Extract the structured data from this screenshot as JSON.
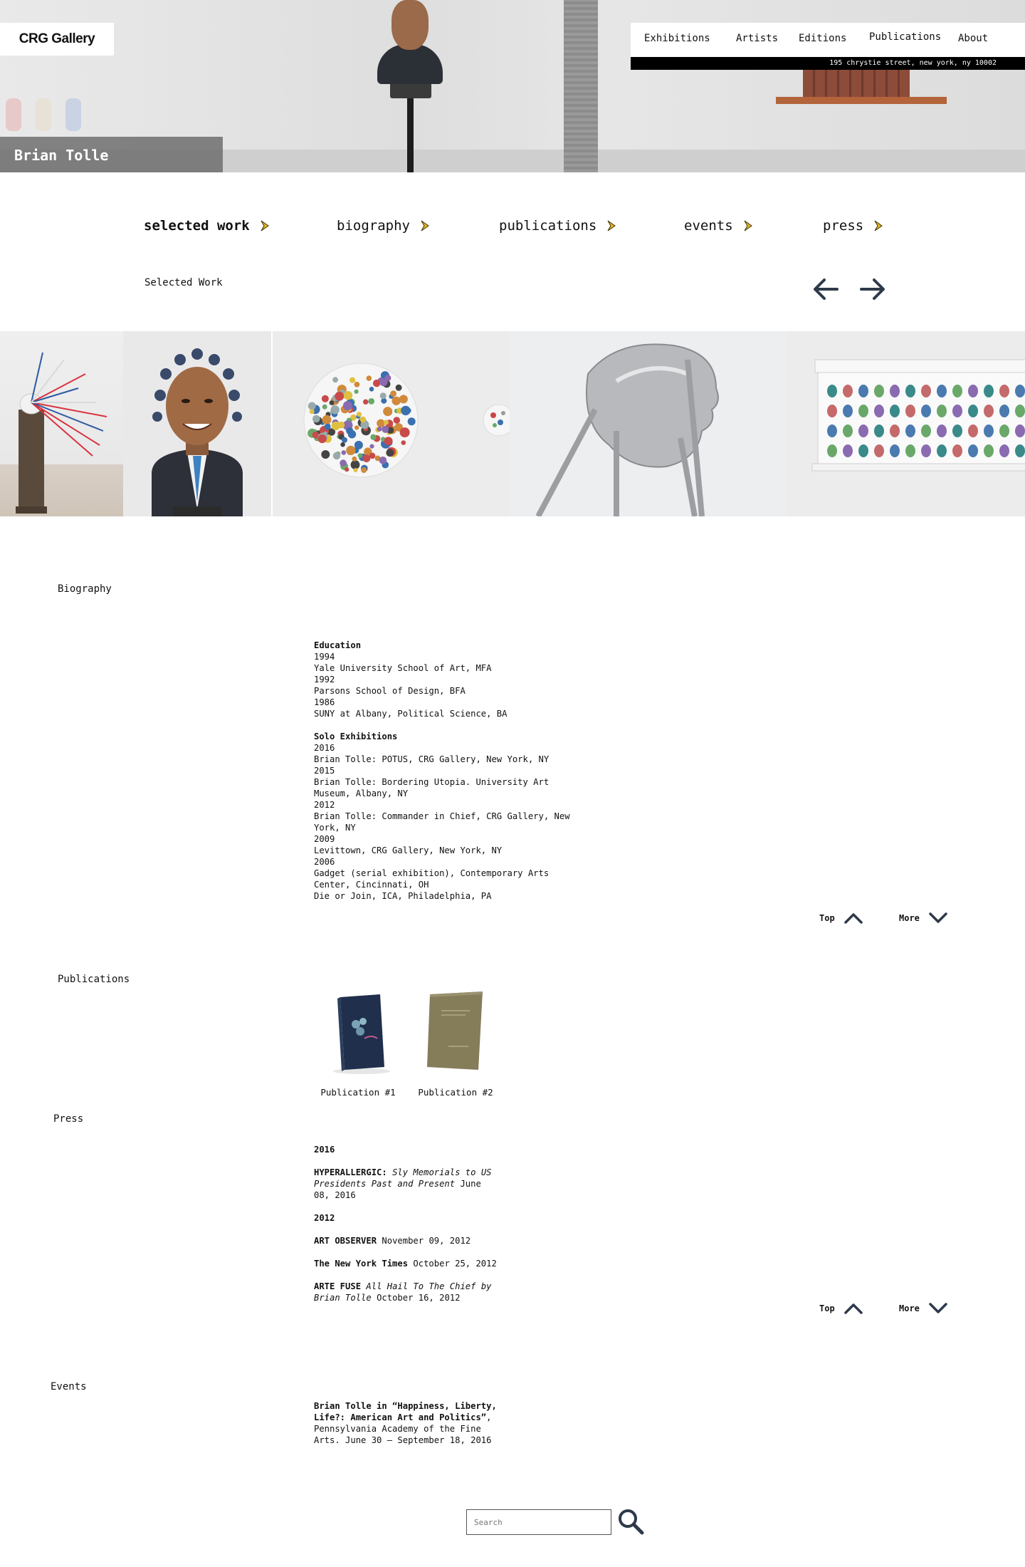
{
  "header": {
    "logo": "CRG Gallery",
    "nav": [
      "Exhibitions",
      "Artists",
      "Editions",
      "Publications",
      "About"
    ],
    "address": "195 chrystie street, new york, ny 10002"
  },
  "artist": {
    "name": "Brian Tolle"
  },
  "tabs": [
    {
      "label": "selected work",
      "active": true
    },
    {
      "label": "biography",
      "active": false
    },
    {
      "label": "publications",
      "active": false
    },
    {
      "label": "events",
      "active": false
    },
    {
      "label": "press",
      "active": false
    }
  ],
  "icons": {
    "tab_chevron": "chevron-right-icon",
    "prev": "arrow-left-icon",
    "next": "arrow-right-icon",
    "top": "chevron-up-icon",
    "more": "chevron-down-icon",
    "search": "search-icon"
  },
  "colors": {
    "chevron": "#e8b923",
    "arrow": "#2e3a4a",
    "address_bar": "#000000"
  },
  "selected_work": {
    "title": "Selected Work"
  },
  "biography": {
    "title": "Biography",
    "education_header": "Education",
    "education": [
      "1994",
      "Yale University School of Art, MFA",
      "1992",
      "Parsons School of Design, BFA",
      "1986",
      "SUNY at Albany, Political Science, BA"
    ],
    "solo_header": "Solo Exhibitions",
    "solo": [
      "2016",
      "Brian Tolle: POTUS, CRG Gallery, New York, NY",
      "2015",
      "Brian Tolle: Bordering Utopia. University Art Museum, Albany, NY",
      "2012",
      "Brian Tolle: Commander in Chief, CRG Gallery, New York, NY",
      "2009",
      "Levittown, CRG Gallery, New York, NY",
      "2006",
      "Gadget (serial exhibition), Contemporary Arts Center, Cincinnati, OH",
      "Die or Join, ICA, Philadelphia, PA"
    ]
  },
  "controls": {
    "top": "Top",
    "more": "More"
  },
  "publications": {
    "title": "Publications",
    "items": [
      "Publication #1",
      "Publication #2"
    ]
  },
  "press": {
    "title": "Press",
    "y2016": "2016",
    "p1_source": "HYPERALLERGIC:",
    "p1_title": "Sly Memorials to US Presidents Past and Present",
    "p1_date": "June 08, 2016",
    "y2012": "2012",
    "p2_source": "ART OBSERVER",
    "p2_date": "November 09, 2012",
    "p3_source": "The New York Times",
    "p3_date": "October 25, 2012",
    "p4_source": "ARTE FUSE",
    "p4_title": "All Hail To The Chief by Brian Tolle",
    "p4_date": "October 16, 2012"
  },
  "events": {
    "title": "Events",
    "e1_title": "Brian Tolle in “Happiness, Liberty, Life?: American Art and Politics”",
    "e1_rest": ", Pennsylvania Academy of the Fine Arts. June 30 – September 18, 2016"
  },
  "search": {
    "placeholder": "Search"
  }
}
